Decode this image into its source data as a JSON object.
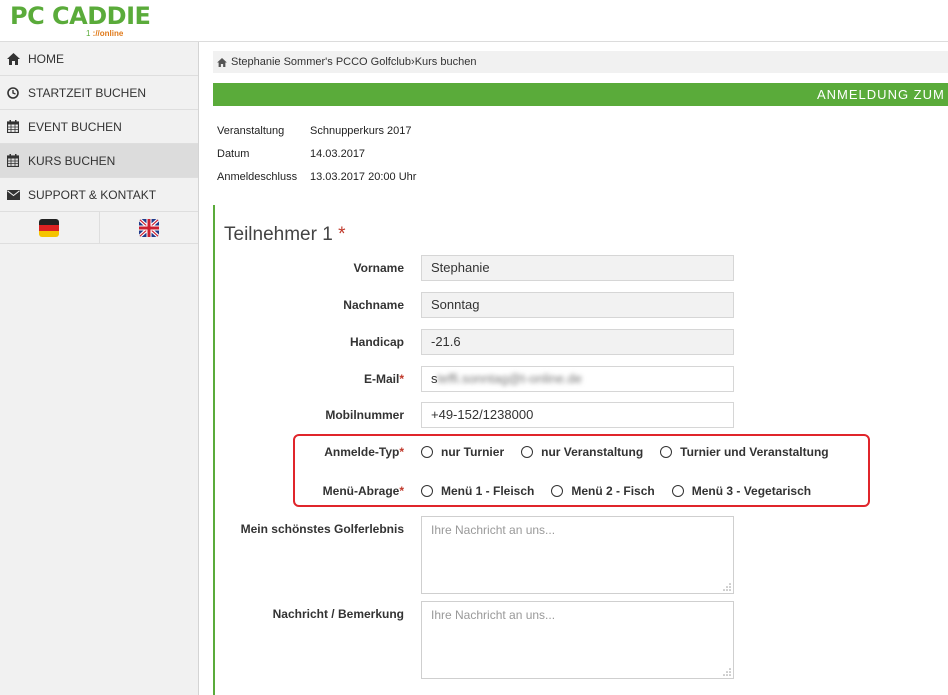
{
  "brand": {
    "logo_text": "PC CADDIE",
    "logo_sub_prefix": "1 ",
    "logo_sub_suffix": "://online"
  },
  "sidebar": {
    "items": [
      {
        "label": "HOME",
        "icon": "home-icon"
      },
      {
        "label": "STARTZEIT BUCHEN",
        "icon": "clock-icon"
      },
      {
        "label": "EVENT BUCHEN",
        "icon": "calendar-icon"
      },
      {
        "label": "KURS BUCHEN",
        "icon": "calendar-icon",
        "active": true
      },
      {
        "label": "SUPPORT & KONTAKT",
        "icon": "envelope-icon"
      }
    ],
    "languages": [
      "de-flag-icon",
      "uk-flag-icon"
    ]
  },
  "breadcrumb": {
    "club": "Stephanie Sommer's PCCO Golfclub",
    "separator": " › ",
    "page": "Kurs buchen"
  },
  "banner": {
    "text": "ANMELDUNG ZUM K"
  },
  "event_info": [
    {
      "label": "Veranstaltung",
      "value": "Schnupperkurs 2017"
    },
    {
      "label": "Datum",
      "value": "14.03.2017"
    },
    {
      "label": "Anmeldeschluss",
      "value": "13.03.2017 20:00 Uhr"
    }
  ],
  "participant": {
    "title": "Teilnehmer 1",
    "required_mark": "*",
    "fields": {
      "vorname": {
        "label": "Vorname",
        "value": "Stephanie"
      },
      "nachname": {
        "label": "Nachname",
        "value": "Sonntag"
      },
      "handicap": {
        "label": "Handicap",
        "value": "-21.6"
      },
      "email": {
        "label": "E-Mail",
        "value_visible": "s",
        "value_blurred": "teffi.sonntag@t-online.de"
      },
      "mobil": {
        "label": "Mobilnummer",
        "value": "+49-152/1238000"
      }
    },
    "anmelde_typ": {
      "label": "Anmelde-Typ",
      "options": [
        "nur Turnier",
        "nur Veranstaltung",
        "Turnier und Veranstaltung"
      ]
    },
    "menu": {
      "label": "Menü-Abrage",
      "options": [
        "Menü 1 - Fleisch",
        "Menü 2 - Fisch",
        "Menü 3 - Vegetarisch"
      ]
    },
    "golferlebnis": {
      "label": "Mein schönstes Golferlebnis",
      "placeholder": "Ihre Nachricht an uns..."
    },
    "nachricht": {
      "label": "Nachricht / Bemerkung",
      "placeholder": "Ihre Nachricht an uns..."
    }
  },
  "colors": {
    "brand_green": "#5aab3a",
    "highlight_red": "#e0252b",
    "required_red": "#c0392b"
  }
}
